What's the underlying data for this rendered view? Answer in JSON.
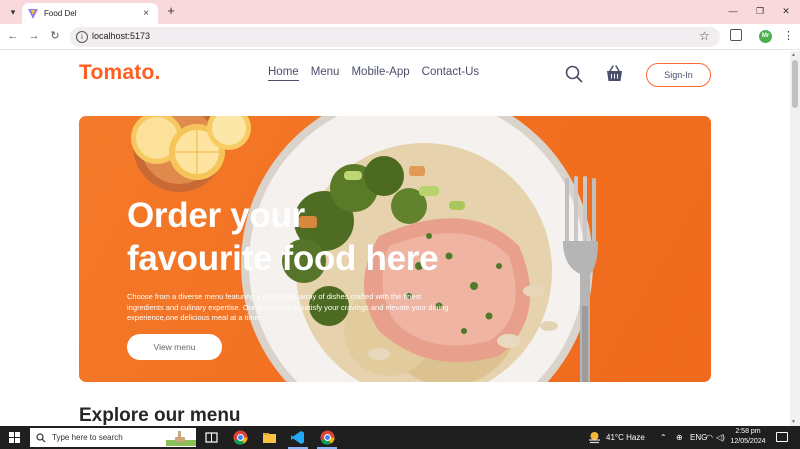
{
  "browser": {
    "tab_title": "Food Del",
    "url": "localhost:5173",
    "profile_initials": "Mr"
  },
  "site": {
    "logo": "Tomato.",
    "nav": [
      {
        "label": "Home",
        "active": true
      },
      {
        "label": "Menu",
        "active": false
      },
      {
        "label": "Mobile-App",
        "active": false
      },
      {
        "label": "Contact-Us",
        "active": false
      }
    ],
    "signin_label": "Sign-In"
  },
  "hero": {
    "title_line1": "Order your",
    "title_line2": "favourite food here",
    "description": "Choose from a diverse menu featuring a delectable array of dishes crafted with the finest ingredients and culinary expertise. Our mission is to satisfy your cravings and elevate your dining experience,one delicious meal at a time.",
    "button_label": "View menu"
  },
  "explore": {
    "heading": "Explore our menu"
  },
  "taskbar": {
    "search_placeholder": "Type here to search",
    "weather": "41°C  Haze",
    "time": "2:58 pm",
    "date": "12/05/2024"
  },
  "colors": {
    "brand": "#ff5e1f",
    "hero_bg": "#f26f20",
    "nav_text": "#4a4f6a",
    "tabstrip": "#f9d9dc"
  },
  "icons": {
    "search": "search-icon",
    "basket": "basket-icon",
    "star": "star-icon",
    "extensions": "puzzle-icon"
  }
}
